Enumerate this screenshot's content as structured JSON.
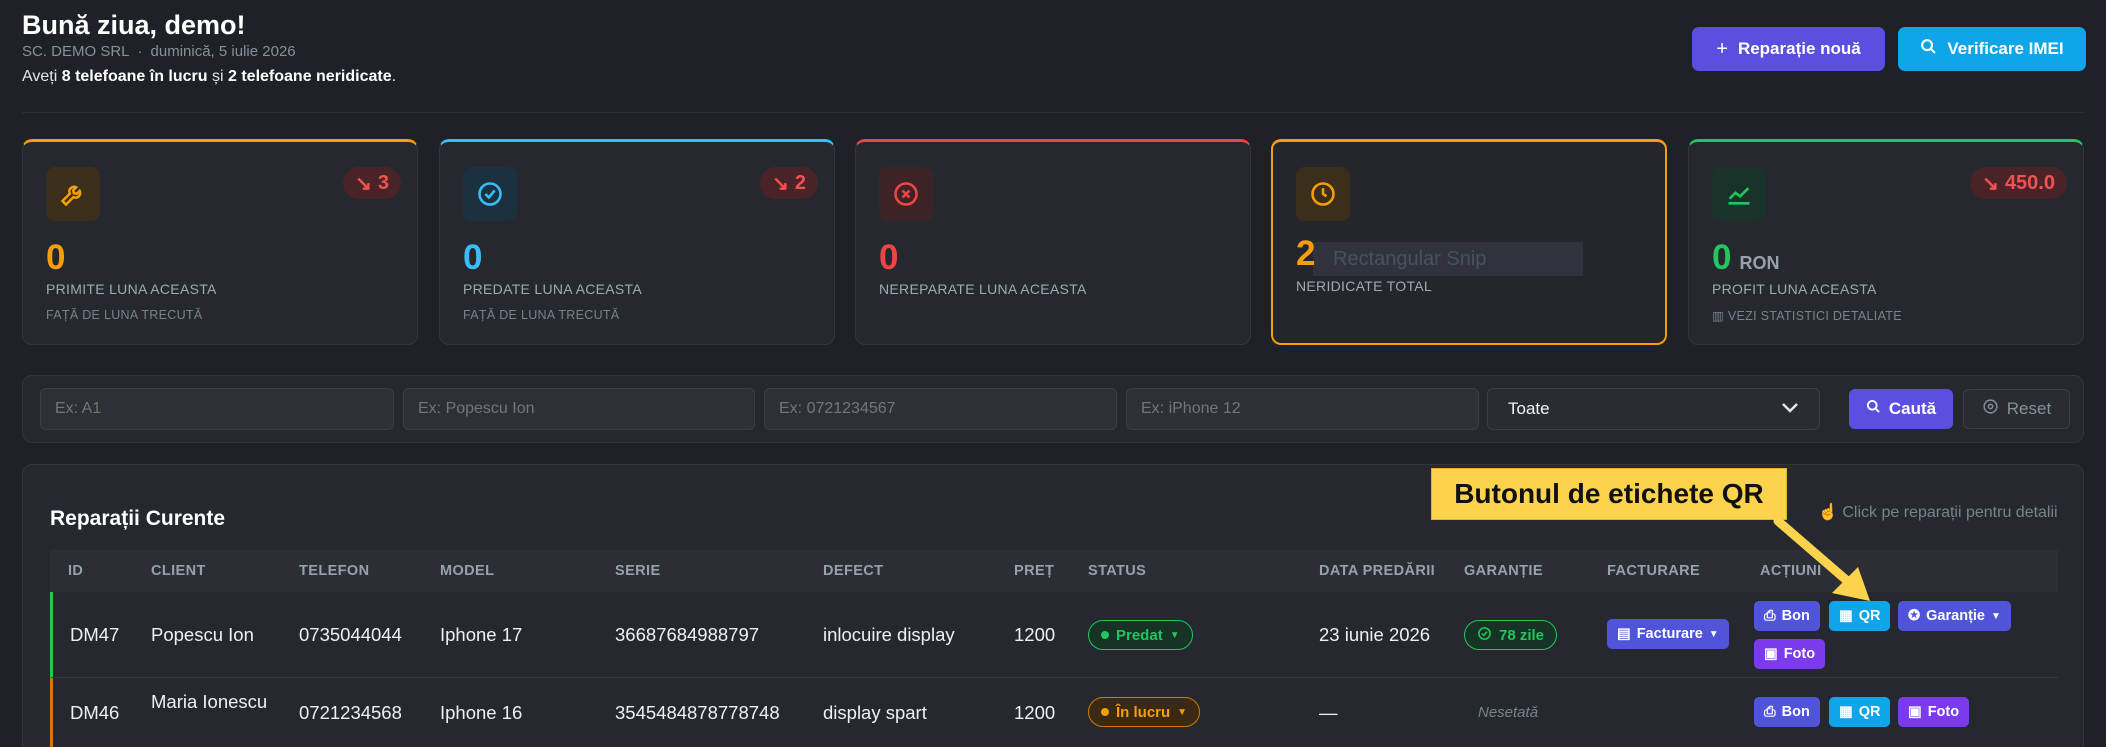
{
  "header": {
    "greeting": "Bună ziua, demo!",
    "company": "SC. DEMO SRL",
    "separator": "·",
    "date": "duminică, 5 iulie 2026",
    "summary_pre": "Aveți ",
    "summary_count1": "8 telefoane în lucru",
    "summary_mid": " și ",
    "summary_count2": "2 telefoane neridicate",
    "summary_post": ".",
    "new_repair_label": "Reparație nouă",
    "imei_label": "Verificare IMEI"
  },
  "cards": [
    {
      "value": "0",
      "label": "PRIMITE LUNA ACEASTA",
      "sub": "FAȚĂ DE LUNA TRECUTĂ",
      "trend": "3",
      "accent": "#f59e0b",
      "icon": "wrench-icon"
    },
    {
      "value": "0",
      "label": "PREDATE LUNA ACEASTA",
      "sub": "FAȚĂ DE LUNA TRECUTĂ",
      "trend": "2",
      "accent": "#38bdf8",
      "icon": "check-circle-icon"
    },
    {
      "value": "0",
      "label": "NEREPARATE LUNA ACEASTA",
      "accent": "#ef4444",
      "icon": "x-circle-icon"
    },
    {
      "value": "2",
      "label": "NERIDICATE TOTAL",
      "overlay": "Rectangular Snip",
      "accent": "#f59e0b",
      "icon": "clock-icon"
    },
    {
      "value": "0",
      "unit": "RON",
      "label": "PROFIT LUNA ACEASTA",
      "sub": "VEZI STATISTICI DETALIATE",
      "trend": "450.0",
      "accent": "#22c55e",
      "icon": "chart-line-icon"
    }
  ],
  "filters": {
    "id_placeholder": "Ex: A1",
    "client_placeholder": "Ex: Popescu Ion",
    "phone_placeholder": "Ex: 0721234567",
    "model_placeholder": "Ex: iPhone 12",
    "status_selected": "Toate",
    "search_label": "Caută",
    "reset_label": "Reset"
  },
  "table": {
    "title": "Reparații Curente",
    "hint": "Click pe reparații pentru detalii",
    "columns": [
      "ID",
      "CLIENT",
      "TELEFON",
      "MODEL",
      "SERIE",
      "DEFECT",
      "PREȚ",
      "STATUS",
      "DATA PREDĂRII",
      "GARANȚIE",
      "FACTURARE",
      "ACȚIUNI"
    ],
    "rows": [
      {
        "id": "DM47",
        "client": "Popescu Ion",
        "phone": "0735044044",
        "model": "Iphone 17",
        "serie": "36687684988797",
        "defect": "inlocuire display",
        "price": "1200",
        "status": "Predat",
        "date": "23 iunie 2026",
        "warranty": "78 zile",
        "billing": "Facturare"
      },
      {
        "id": "DM46",
        "client": "Maria Ionescu",
        "phone": "0721234568",
        "model": "Iphone 16",
        "serie": "3545484878778748",
        "defect": "display spart",
        "price": "1200",
        "status": "În lucru",
        "date": "—",
        "warranty": "Nesetată",
        "billing": ""
      }
    ],
    "actions": {
      "bon": "Bon",
      "qr": "QR",
      "garantie": "Garanție",
      "foto": "Foto"
    }
  },
  "annotation": {
    "text": "Butonul de etichete QR"
  },
  "colors": {
    "background": "#1f2128",
    "primary": "#5b4fe0",
    "info": "#0ea5e9",
    "success": "#22c55e",
    "warning": "#f59e0b",
    "danger": "#ef4444"
  }
}
